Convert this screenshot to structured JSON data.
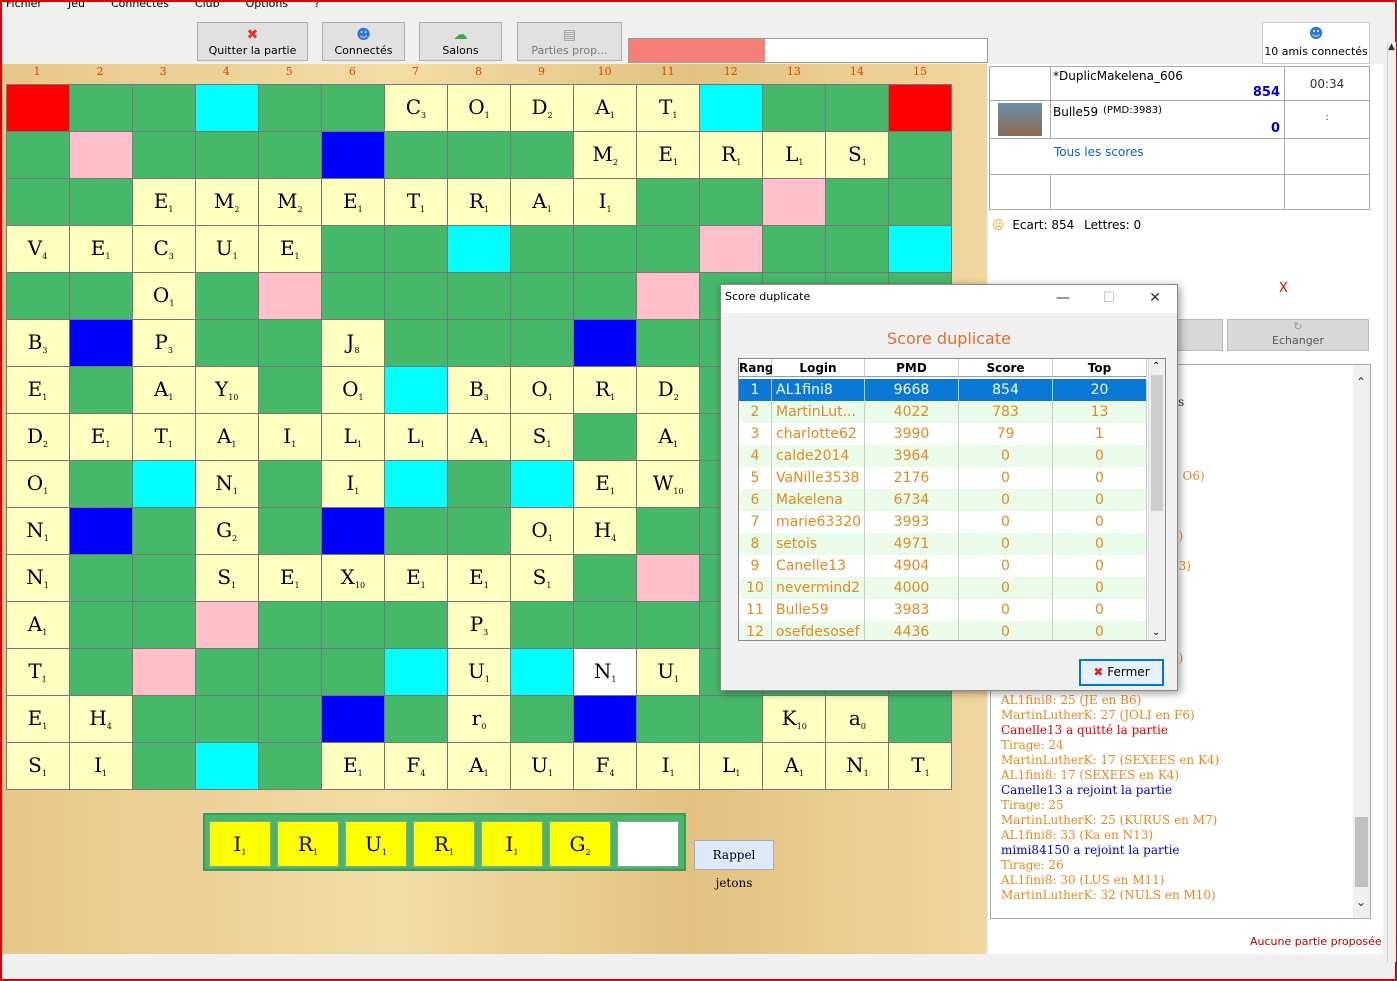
{
  "menu": [
    "Fichier",
    "Jeu",
    "Connectés",
    "Club",
    "Options",
    "?"
  ],
  "toolbar": {
    "quit_label": "Quitter la partie",
    "connected_label": "Connectés",
    "rooms_label": "Salons",
    "proposed_label": "Parties prop...",
    "friends_label": "10 amis connectés",
    "progress": 0.38
  },
  "colors": {
    "accent": "#0a78d7",
    "orange": "#e08a20",
    "red": "#e00000",
    "green": "#46b86a",
    "tile": "#ffffc0",
    "rack_tile": "#ffff00"
  },
  "board": {
    "col_headers": [
      "1",
      "2",
      "3",
      "4",
      "5",
      "6",
      "7",
      "8",
      "9",
      "10",
      "11",
      "12",
      "13",
      "14",
      "15"
    ],
    "rows": [
      [
        [
          "r"
        ],
        [
          "g"
        ],
        [
          "g"
        ],
        [
          "c"
        ],
        [
          "g"
        ],
        [
          "g"
        ],
        [
          "t",
          "C",
          "3"
        ],
        [
          "t",
          "O",
          "1"
        ],
        [
          "t",
          "D",
          "2"
        ],
        [
          "t",
          "A",
          "1"
        ],
        [
          "t",
          "T",
          "1"
        ],
        [
          "c"
        ],
        [
          "g"
        ],
        [
          "g"
        ],
        [
          "r"
        ]
      ],
      [
        [
          "g"
        ],
        [
          "p"
        ],
        [
          "g"
        ],
        [
          "g"
        ],
        [
          "g"
        ],
        [
          "b"
        ],
        [
          "g"
        ],
        [
          "g"
        ],
        [
          "g"
        ],
        [
          "t",
          "M",
          "2"
        ],
        [
          "t",
          "E",
          "1"
        ],
        [
          "t",
          "R",
          "1"
        ],
        [
          "t",
          "L",
          "1"
        ],
        [
          "t",
          "S",
          "1"
        ],
        [
          "g"
        ]
      ],
      [
        [
          "g"
        ],
        [
          "g"
        ],
        [
          "t",
          "E",
          "1"
        ],
        [
          "t",
          "M",
          "2"
        ],
        [
          "t",
          "M",
          "2"
        ],
        [
          "t",
          "E",
          "1"
        ],
        [
          "t",
          "T",
          "1"
        ],
        [
          "t",
          "R",
          "1"
        ],
        [
          "t",
          "A",
          "1"
        ],
        [
          "t",
          "I",
          "1"
        ],
        [
          "g"
        ],
        [
          "g"
        ],
        [
          "p"
        ],
        [
          "g"
        ],
        [
          "g"
        ]
      ],
      [
        [
          "t",
          "V",
          "4"
        ],
        [
          "t",
          "E",
          "1"
        ],
        [
          "t",
          "C",
          "3"
        ],
        [
          "t",
          "U",
          "1"
        ],
        [
          "t",
          "E",
          "1"
        ],
        [
          "g"
        ],
        [
          "g"
        ],
        [
          "c"
        ],
        [
          "g"
        ],
        [
          "g"
        ],
        [
          "g"
        ],
        [
          "p"
        ],
        [
          "g"
        ],
        [
          "g"
        ],
        [
          "c"
        ]
      ],
      [
        [
          "g"
        ],
        [
          "g"
        ],
        [
          "t",
          "O",
          "1"
        ],
        [
          "g"
        ],
        [
          "p"
        ],
        [
          "g"
        ],
        [
          "g"
        ],
        [
          "g"
        ],
        [
          "g"
        ],
        [
          "g"
        ],
        [
          "p"
        ],
        [
          "g"
        ],
        [
          "g"
        ],
        [
          "g"
        ],
        [
          "g"
        ]
      ],
      [
        [
          "t",
          "B",
          "3"
        ],
        [
          "b"
        ],
        [
          "t",
          "P",
          "3"
        ],
        [
          "g"
        ],
        [
          "g"
        ],
        [
          "t",
          "J",
          "8"
        ],
        [
          "g"
        ],
        [
          "g"
        ],
        [
          "g"
        ],
        [
          "b"
        ],
        [
          "g"
        ],
        [
          "g"
        ],
        [
          "g"
        ],
        [
          "g"
        ],
        [
          "g"
        ]
      ],
      [
        [
          "t",
          "E",
          "1"
        ],
        [
          "g"
        ],
        [
          "t",
          "A",
          "1"
        ],
        [
          "t",
          "Y",
          "10"
        ],
        [
          "g"
        ],
        [
          "t",
          "O",
          "1"
        ],
        [
          "c"
        ],
        [
          "t",
          "B",
          "3"
        ],
        [
          "t",
          "O",
          "1"
        ],
        [
          "t",
          "R",
          "1"
        ],
        [
          "t",
          "D",
          "2"
        ],
        [
          "g"
        ],
        [
          "g"
        ],
        [
          "g"
        ],
        [
          "g"
        ]
      ],
      [
        [
          "t",
          "D",
          "2"
        ],
        [
          "t",
          "E",
          "1"
        ],
        [
          "t",
          "T",
          "1"
        ],
        [
          "t",
          "A",
          "1"
        ],
        [
          "t",
          "I",
          "1"
        ],
        [
          "t",
          "L",
          "1"
        ],
        [
          "t",
          "L",
          "1"
        ],
        [
          "t",
          "A",
          "1"
        ],
        [
          "t",
          "S",
          "1"
        ],
        [
          "g"
        ],
        [
          "t",
          "A",
          "1"
        ],
        [
          "g"
        ],
        [
          "g"
        ],
        [
          "g"
        ],
        [
          "g"
        ]
      ],
      [
        [
          "t",
          "O",
          "1"
        ],
        [
          "g"
        ],
        [
          "c"
        ],
        [
          "t",
          "N",
          "1"
        ],
        [
          "g"
        ],
        [
          "t",
          "I",
          "1"
        ],
        [
          "c"
        ],
        [
          "g"
        ],
        [
          "c"
        ],
        [
          "t",
          "E",
          "1"
        ],
        [
          "t",
          "W",
          "10"
        ],
        [
          "g"
        ],
        [
          "g"
        ],
        [
          "g"
        ],
        [
          "g"
        ]
      ],
      [
        [
          "t",
          "N",
          "1"
        ],
        [
          "b"
        ],
        [
          "g"
        ],
        [
          "t",
          "G",
          "2"
        ],
        [
          "g"
        ],
        [
          "b"
        ],
        [
          "g"
        ],
        [
          "g"
        ],
        [
          "t",
          "O",
          "1"
        ],
        [
          "t",
          "H",
          "4"
        ],
        [
          "g"
        ],
        [
          "g"
        ],
        [
          "g"
        ],
        [
          "g"
        ],
        [
          "g"
        ]
      ],
      [
        [
          "t",
          "N",
          "1"
        ],
        [
          "g"
        ],
        [
          "g"
        ],
        [
          "t",
          "S",
          "1"
        ],
        [
          "t",
          "E",
          "1"
        ],
        [
          "t",
          "X",
          "10"
        ],
        [
          "t",
          "E",
          "1"
        ],
        [
          "t",
          "E",
          "1"
        ],
        [
          "t",
          "S",
          "1"
        ],
        [
          "g"
        ],
        [
          "p"
        ],
        [
          "g"
        ],
        [
          "g"
        ],
        [
          "g"
        ],
        [
          "g"
        ]
      ],
      [
        [
          "t",
          "A",
          "1"
        ],
        [
          "g"
        ],
        [
          "g"
        ],
        [
          "p"
        ],
        [
          "g"
        ],
        [
          "g"
        ],
        [
          "g"
        ],
        [
          "t",
          "P",
          "3"
        ],
        [
          "g"
        ],
        [
          "g"
        ],
        [
          "g"
        ],
        [
          "g"
        ],
        [
          "g"
        ],
        [
          "g"
        ],
        [
          "g"
        ]
      ],
      [
        [
          "t",
          "T",
          "1"
        ],
        [
          "g"
        ],
        [
          "p"
        ],
        [
          "g"
        ],
        [
          "g"
        ],
        [
          "g"
        ],
        [
          "c"
        ],
        [
          "t",
          "U",
          "1"
        ],
        [
          "c"
        ],
        [
          "w",
          "N",
          "1"
        ],
        [
          "t",
          "U",
          "1"
        ],
        [
          "g"
        ],
        [
          "g"
        ],
        [
          "g"
        ],
        [
          "g"
        ]
      ],
      [
        [
          "t",
          "E",
          "1"
        ],
        [
          "t",
          "H",
          "4"
        ],
        [
          "g"
        ],
        [
          "g"
        ],
        [
          "g"
        ],
        [
          "b"
        ],
        [
          "g"
        ],
        [
          "t",
          "r",
          "0"
        ],
        [
          "g"
        ],
        [
          "b"
        ],
        [
          "g"
        ],
        [
          "g"
        ],
        [
          "t",
          "K",
          "10"
        ],
        [
          "t",
          "a",
          "0"
        ],
        [
          "g"
        ]
      ],
      [
        [
          "t",
          "S",
          "1"
        ],
        [
          "t",
          "I",
          "1"
        ],
        [
          "g"
        ],
        [
          "c"
        ],
        [
          "g"
        ],
        [
          "t",
          "E",
          "1"
        ],
        [
          "t",
          "F",
          "4"
        ],
        [
          "t",
          "A",
          "1"
        ],
        [
          "t",
          "U",
          "1"
        ],
        [
          "t",
          "F",
          "4"
        ],
        [
          "t",
          "I",
          "1"
        ],
        [
          "t",
          "L",
          "1"
        ],
        [
          "t",
          "A",
          "1"
        ],
        [
          "t",
          "N",
          "1"
        ],
        [
          "t",
          "T",
          "1"
        ]
      ]
    ]
  },
  "rack": {
    "tiles": [
      [
        "I",
        "1"
      ],
      [
        "R",
        "1"
      ],
      [
        "U",
        "1"
      ],
      [
        "R",
        "1"
      ],
      [
        "I",
        "1"
      ],
      [
        "G",
        "2"
      ],
      [
        "",
        ""
      ]
    ],
    "recall_label": "Rappel jetons"
  },
  "scores": {
    "player1": {
      "name": "*DuplicMakelena_606",
      "score": "854",
      "time": "00:34"
    },
    "player2": {
      "name": "Bulle59",
      "pmd": "(PMD:3983)",
      "score": "0",
      "time": ":"
    },
    "all_scores_link": "Tous les scores",
    "ecart": "Ecart: 854",
    "lettres": "Lettres: 0"
  },
  "right": {
    "x_mark": "X",
    "exchange_label": "Echanger",
    "no_game": "Aucune partie proposée"
  },
  "chat": [
    {
      "t": "AL1fini8: 25 (JE en B6)",
      "c": "o"
    },
    {
      "t": "MartinLutherK: 27 (JOLI en F6)",
      "c": "o"
    },
    {
      "t": "Canelle13 a quitté la partie",
      "c": "red"
    },
    {
      "t": "Tirage: 24",
      "c": "o"
    },
    {
      "t": "MartinLutherK: 17 (SEXEES en K4)",
      "c": "o"
    },
    {
      "t": "AL1fini8: 17 (SEXEES en K4)",
      "c": "o"
    },
    {
      "t": "Canelle13 a rejoint la partie",
      "c": "blue"
    },
    {
      "t": "Tirage: 25",
      "c": "o"
    },
    {
      "t": "MartinLutherK: 25 (KURUS en M7)",
      "c": "o"
    },
    {
      "t": "AL1fini8: 33 (Ka en N13)",
      "c": "o"
    },
    {
      "t": "mimi84150 a rejoint la partie",
      "c": "blue"
    },
    {
      "t": "Tirage: 26",
      "c": "o"
    },
    {
      "t": "AL1fini8: 30 (LUS en M11)",
      "c": "o"
    },
    {
      "t": "MartinLutherK: 32 (NULS en M10)",
      "c": "o"
    }
  ],
  "chat_partial": [
    "es",
    "n O6)",
    ")",
    "6)",
    "13)",
    "7)"
  ],
  "dialog": {
    "title": "Score duplicate",
    "heading": "Score duplicate",
    "headers": [
      "Rang",
      "Login",
      "PMD",
      "Score",
      "Top"
    ],
    "rows": [
      [
        "1",
        "AL1fini8",
        "9668",
        "854",
        "20"
      ],
      [
        "2",
        "MartinLut...",
        "4022",
        "783",
        "13"
      ],
      [
        "3",
        "charlotte62",
        "3990",
        "79",
        "1"
      ],
      [
        "4",
        "calde2014",
        "3964",
        "0",
        "0"
      ],
      [
        "5",
        "VaNille3538",
        "2176",
        "0",
        "0"
      ],
      [
        "6",
        "Makelena",
        "6734",
        "0",
        "0"
      ],
      [
        "7",
        "marie63320",
        "3993",
        "0",
        "0"
      ],
      [
        "8",
        "setois",
        "4971",
        "0",
        "0"
      ],
      [
        "9",
        "Canelle13",
        "4904",
        "0",
        "0"
      ],
      [
        "10",
        "nevermind2",
        "4000",
        "0",
        "0"
      ],
      [
        "11",
        "Bulle59",
        "3983",
        "0",
        "0"
      ],
      [
        "12",
        "osefdesosef",
        "4436",
        "0",
        "0"
      ]
    ],
    "close_label": "Fermer"
  }
}
